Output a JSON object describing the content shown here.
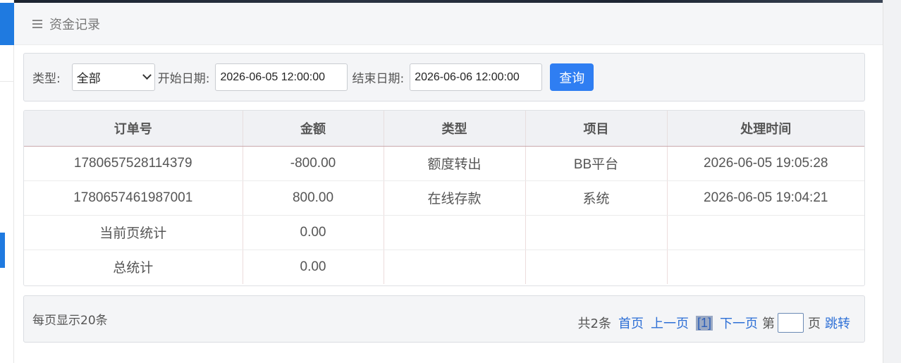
{
  "header": {
    "title": "资金记录",
    "menu_icon": "hamburger-icon"
  },
  "filter": {
    "type_label": "类型:",
    "type_value": "全部",
    "start_label": "开始日期:",
    "start_value": "2026-06-05 12:00:00",
    "end_label": "结束日期:",
    "end_value": "2026-06-06 12:00:00",
    "query_label": "查询"
  },
  "table": {
    "columns": [
      "订单号",
      "金额",
      "类型",
      "项目",
      "处理时间"
    ],
    "rows": [
      [
        "1780657528114379",
        "-800.00",
        "额度转出",
        "BB平台",
        "2026-06-05 19:05:28"
      ],
      [
        "1780657461987001",
        "800.00",
        "在线存款",
        "系统",
        "2026-06-05 19:04:21"
      ],
      [
        "当前页统计",
        "0.00",
        "",
        "",
        ""
      ],
      [
        "总统计",
        "0.00",
        "",
        "",
        ""
      ]
    ]
  },
  "pager": {
    "per_page": "每页显示20条",
    "total": "共2条",
    "first": "首页",
    "prev": "上一页",
    "current": "[1]",
    "next": "下一页",
    "page_prefix": "第",
    "page_suffix": "页",
    "jump": "跳转"
  },
  "colors": {
    "accent": "#2f7ef2",
    "link": "#2d6fd6"
  }
}
